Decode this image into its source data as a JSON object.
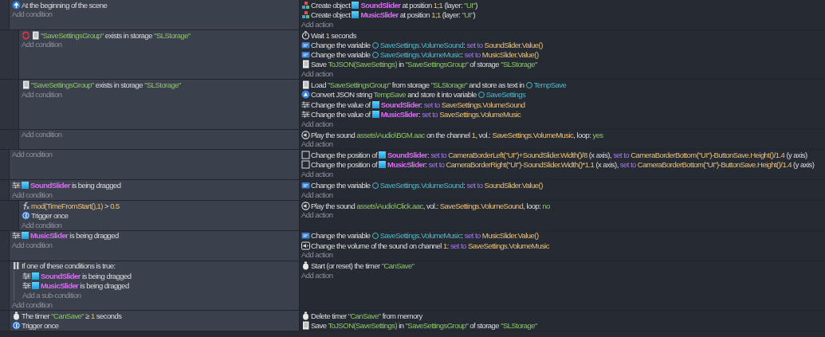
{
  "events": [
    {
      "conditions": [
        {
          "kind": "start",
          "inverted": false,
          "parts": [
            {
              "kind": "plain",
              "text": "At the beginning of the scene"
            }
          ]
        }
      ],
      "add_condition": "Add condition",
      "actions": [
        {
          "kind": "create",
          "parts": [
            {
              "kind": "plain",
              "text": "Create object "
            },
            {
              "kind": "object",
              "text": "SoundSlider"
            },
            {
              "kind": "plain",
              "text": " at position "
            },
            {
              "kind": "number",
              "text": "1;1"
            },
            {
              "kind": "plain",
              "text": " (layer: "
            },
            {
              "kind": "string",
              "text": "\"UI\""
            },
            {
              "kind": "plain",
              "text": ")"
            }
          ]
        },
        {
          "kind": "create",
          "parts": [
            {
              "kind": "plain",
              "text": "Create object "
            },
            {
              "kind": "object",
              "text": "MusicSlider"
            },
            {
              "kind": "plain",
              "text": " at position "
            },
            {
              "kind": "number",
              "text": "1;1"
            },
            {
              "kind": "plain",
              "text": " (layer: "
            },
            {
              "kind": "string",
              "text": "\"UI\""
            },
            {
              "kind": "plain",
              "text": ")"
            }
          ]
        }
      ],
      "add_action": "Add action",
      "children": [
        {
          "conditions": [
            {
              "kind": "storage",
              "inverted": true,
              "parts": [
                {
                  "kind": "string",
                  "text": "\"SaveSettingsGroup\""
                },
                {
                  "kind": "plain",
                  "text": " exists in storage "
                },
                {
                  "kind": "string",
                  "text": "\"SLStorage\""
                }
              ]
            }
          ],
          "add_condition": "Add condition",
          "actions": [
            {
              "kind": "wait",
              "parts": [
                {
                  "kind": "plain",
                  "text": "Wait "
                },
                {
                  "kind": "number",
                  "text": "1"
                },
                {
                  "kind": "plain",
                  "text": " seconds"
                }
              ]
            },
            {
              "kind": "variable",
              "parts": [
                {
                  "kind": "plain",
                  "text": "Change the variable "
                },
                {
                  "kind": "variable",
                  "text": "SaveSettings.VolumeSound"
                },
                {
                  "kind": "plain",
                  "text": ": "
                },
                {
                  "kind": "keyword",
                  "text": "set to "
                },
                {
                  "kind": "expression",
                  "text": "SoundSlider.Value()"
                }
              ]
            },
            {
              "kind": "variable",
              "parts": [
                {
                  "kind": "plain",
                  "text": "Change the variable "
                },
                {
                  "kind": "variable",
                  "text": "SaveSettings.VolumeMusic"
                },
                {
                  "kind": "plain",
                  "text": ": "
                },
                {
                  "kind": "keyword",
                  "text": "set to "
                },
                {
                  "kind": "expression",
                  "text": "MusicSlider.Value()"
                }
              ]
            },
            {
              "kind": "storage",
              "parts": [
                {
                  "kind": "plain",
                  "text": "Save "
                },
                {
                  "kind": "string",
                  "text": "ToJSON(SaveSettings)"
                },
                {
                  "kind": "plain",
                  "text": " in "
                },
                {
                  "kind": "string",
                  "text": "\"SaveSettingsGroup\""
                },
                {
                  "kind": "plain",
                  "text": " of storage "
                },
                {
                  "kind": "string",
                  "text": "\"SLStorage\""
                }
              ]
            }
          ],
          "add_action": "Add action"
        },
        {
          "conditions": [
            {
              "kind": "storage",
              "inverted": false,
              "parts": [
                {
                  "kind": "string",
                  "text": "\"SaveSettingsGroup\""
                },
                {
                  "kind": "plain",
                  "text": " exists in storage "
                },
                {
                  "kind": "string",
                  "text": "\"SLStorage\""
                }
              ]
            }
          ],
          "add_condition": "Add condition",
          "actions": [
            {
              "kind": "storage",
              "parts": [
                {
                  "kind": "plain",
                  "text": "Load "
                },
                {
                  "kind": "string",
                  "text": "\"SaveSettingsGroup\""
                },
                {
                  "kind": "plain",
                  "text": " from storage "
                },
                {
                  "kind": "string",
                  "text": "\"SLStorage\""
                },
                {
                  "kind": "plain",
                  "text": " and store as text in "
                },
                {
                  "kind": "variable",
                  "text": "TempSave"
                }
              ]
            },
            {
              "kind": "convert",
              "parts": [
                {
                  "kind": "plain",
                  "text": "Convert JSON string "
                },
                {
                  "kind": "string",
                  "text": "TempSave"
                },
                {
                  "kind": "plain",
                  "text": " and store it into variable "
                },
                {
                  "kind": "variable",
                  "text": "SaveSettings"
                }
              ]
            },
            {
              "kind": "slider",
              "parts": [
                {
                  "kind": "plain",
                  "text": "Change the value of "
                },
                {
                  "kind": "object",
                  "text": "SoundSlider"
                },
                {
                  "kind": "plain",
                  "text": ": "
                },
                {
                  "kind": "keyword",
                  "text": "set to "
                },
                {
                  "kind": "expression",
                  "text": "SaveSettings.VolumeSound"
                }
              ]
            },
            {
              "kind": "slider",
              "parts": [
                {
                  "kind": "plain",
                  "text": "Change the value of "
                },
                {
                  "kind": "object",
                  "text": "MusicSlider"
                },
                {
                  "kind": "plain",
                  "text": ": "
                },
                {
                  "kind": "keyword",
                  "text": "set to "
                },
                {
                  "kind": "expression",
                  "text": "SaveSettings.VolumeMusic"
                }
              ]
            }
          ],
          "add_action": "Add action"
        },
        {
          "add_condition": "Add condition",
          "actions": [
            {
              "kind": "sound",
              "parts": [
                {
                  "kind": "plain",
                  "text": "Play the sound "
                },
                {
                  "kind": "string",
                  "text": "assets\\Audio\\BGM.aac"
                },
                {
                  "kind": "plain",
                  "text": " on the channel "
                },
                {
                  "kind": "number",
                  "text": "1"
                },
                {
                  "kind": "plain",
                  "text": ", vol.: "
                },
                {
                  "kind": "expression",
                  "text": "SaveSettings.VolumeMusic"
                },
                {
                  "kind": "plain",
                  "text": ", loop: "
                },
                {
                  "kind": "string",
                  "text": "yes"
                }
              ]
            }
          ],
          "add_action": "Add action"
        }
      ]
    },
    {
      "add_condition": "Add condition",
      "actions": [
        {
          "kind": "position",
          "parts": [
            {
              "kind": "plain",
              "text": "Change the position of "
            },
            {
              "kind": "object",
              "text": "SoundSlider"
            },
            {
              "kind": "plain",
              "text": ": "
            },
            {
              "kind": "keyword",
              "text": "set to "
            },
            {
              "kind": "expression",
              "text": "CameraBorderLeft(\"UI\")+SoundSlider.Width()/8"
            },
            {
              "kind": "plain",
              "text": " (x axis), "
            },
            {
              "kind": "keyword",
              "text": "set to "
            },
            {
              "kind": "expression",
              "text": "CameraBorderBottom(\"UI\")-ButtonSave.Height()/1.4"
            },
            {
              "kind": "plain",
              "text": " (y axis)"
            }
          ]
        },
        {
          "kind": "position",
          "parts": [
            {
              "kind": "plain",
              "text": "Change the position of "
            },
            {
              "kind": "object",
              "text": "MusicSlider"
            },
            {
              "kind": "plain",
              "text": ": "
            },
            {
              "kind": "keyword",
              "text": "set to "
            },
            {
              "kind": "expression",
              "text": "CameraBorderRight(\"UI\")-SoundSlider.Width()*1.1"
            },
            {
              "kind": "plain",
              "text": " (x axis), "
            },
            {
              "kind": "keyword",
              "text": "set to "
            },
            {
              "kind": "expression",
              "text": "CameraBorderBottom(\"UI\")-ButtonSave.Height()/1.4"
            },
            {
              "kind": "plain",
              "text": " (y axis)"
            }
          ]
        }
      ],
      "add_action": "Add action"
    },
    {
      "conditions": [
        {
          "kind": "slider",
          "inverted": false,
          "parts": [
            {
              "kind": "object",
              "text": "SoundSlider"
            },
            {
              "kind": "plain",
              "text": " is being dragged"
            }
          ]
        }
      ],
      "add_condition": "Add condition",
      "actions": [
        {
          "kind": "variable",
          "parts": [
            {
              "kind": "plain",
              "text": "Change the variable "
            },
            {
              "kind": "variable",
              "text": "SaveSettings.VolumeSound"
            },
            {
              "kind": "plain",
              "text": ": "
            },
            {
              "kind": "keyword",
              "text": "set to "
            },
            {
              "kind": "expression",
              "text": "SoundSlider.Value()"
            }
          ]
        }
      ],
      "add_action": "Add action",
      "children": [
        {
          "conditions": [
            {
              "kind": "function",
              "inverted": false,
              "parts": [
                {
                  "kind": "expression",
                  "text": "mod(TimeFromStart(),1)"
                },
                {
                  "kind": "plain",
                  "text": " > "
                },
                {
                  "kind": "number",
                  "text": "0.5"
                }
              ]
            },
            {
              "kind": "trigger",
              "inverted": false,
              "parts": [
                {
                  "kind": "plain",
                  "text": "Trigger once"
                }
              ]
            }
          ],
          "add_condition": "Add condition",
          "actions": [
            {
              "kind": "sound",
              "parts": [
                {
                  "kind": "plain",
                  "text": "Play the sound "
                },
                {
                  "kind": "string",
                  "text": "assets\\Audio\\Click.aac"
                },
                {
                  "kind": "plain",
                  "text": ", vol.: "
                },
                {
                  "kind": "expression",
                  "text": "SaveSettings.VolumeSound"
                },
                {
                  "kind": "plain",
                  "text": ", loop: "
                },
                {
                  "kind": "string",
                  "text": "no"
                }
              ]
            }
          ],
          "add_action": "Add action"
        }
      ]
    },
    {
      "conditions": [
        {
          "kind": "slider",
          "inverted": false,
          "parts": [
            {
              "kind": "object",
              "text": "MusicSlider"
            },
            {
              "kind": "plain",
              "text": " is being dragged"
            }
          ]
        }
      ],
      "add_condition": "Add condition",
      "actions": [
        {
          "kind": "variable",
          "parts": [
            {
              "kind": "plain",
              "text": "Change the variable "
            },
            {
              "kind": "variable",
              "text": "SaveSettings.VolumeMusic"
            },
            {
              "kind": "plain",
              "text": ": "
            },
            {
              "kind": "keyword",
              "text": "set to "
            },
            {
              "kind": "expression",
              "text": "MusicSlider.Value()"
            }
          ]
        },
        {
          "kind": "volume",
          "parts": [
            {
              "kind": "plain",
              "text": "Change the volume of the sound on channel "
            },
            {
              "kind": "number",
              "text": "1"
            },
            {
              "kind": "plain",
              "text": ": "
            },
            {
              "kind": "keyword",
              "text": "set to "
            },
            {
              "kind": "expression",
              "text": "SaveSettings.VolumeMusic"
            }
          ]
        }
      ],
      "add_action": "Add action"
    },
    {
      "conditions": [
        {
          "kind": "or",
          "inverted": false,
          "parts": [
            {
              "kind": "plain",
              "text": "If one of these conditions is true:"
            }
          ],
          "sub_conditions": [
            {
              "kind": "slider",
              "parts": [
                {
                  "kind": "object",
                  "text": "SoundSlider"
                },
                {
                  "kind": "plain",
                  "text": " is being dragged"
                }
              ]
            },
            {
              "kind": "slider",
              "parts": [
                {
                  "kind": "object",
                  "text": "MusicSlider"
                },
                {
                  "kind": "plain",
                  "text": " is being dragged"
                }
              ]
            }
          ],
          "add_sub_condition": "Add a sub-condition"
        }
      ],
      "add_condition": "Add condition",
      "actions": [
        {
          "kind": "timer",
          "parts": [
            {
              "kind": "plain",
              "text": "Start (or reset) the timer "
            },
            {
              "kind": "string",
              "text": "\"CanSave\""
            }
          ]
        }
      ],
      "add_action": "Add action"
    },
    {
      "conditions": [
        {
          "kind": "timer",
          "inverted": false,
          "parts": [
            {
              "kind": "plain",
              "text": "The timer "
            },
            {
              "kind": "string",
              "text": "\"CanSave\""
            },
            {
              "kind": "plain",
              "text": " ≥ "
            },
            {
              "kind": "number",
              "text": "1"
            },
            {
              "kind": "plain",
              "text": " seconds"
            }
          ]
        },
        {
          "kind": "trigger",
          "inverted": false,
          "parts": [
            {
              "kind": "plain",
              "text": "Trigger once"
            }
          ]
        }
      ],
      "actions": [
        {
          "kind": "timer",
          "parts": [
            {
              "kind": "plain",
              "text": "Delete timer "
            },
            {
              "kind": "string",
              "text": "\"CanSave\""
            },
            {
              "kind": "plain",
              "text": " from memory"
            }
          ]
        },
        {
          "kind": "storage",
          "parts": [
            {
              "kind": "plain",
              "text": "Save "
            },
            {
              "kind": "string",
              "text": "ToJSON(SaveSettings)"
            },
            {
              "kind": "plain",
              "text": " in "
            },
            {
              "kind": "string",
              "text": "\"SaveSettingsGroup\""
            },
            {
              "kind": "plain",
              "text": " of storage "
            },
            {
              "kind": "string",
              "text": "\"SLStorage\""
            }
          ]
        }
      ]
    }
  ]
}
